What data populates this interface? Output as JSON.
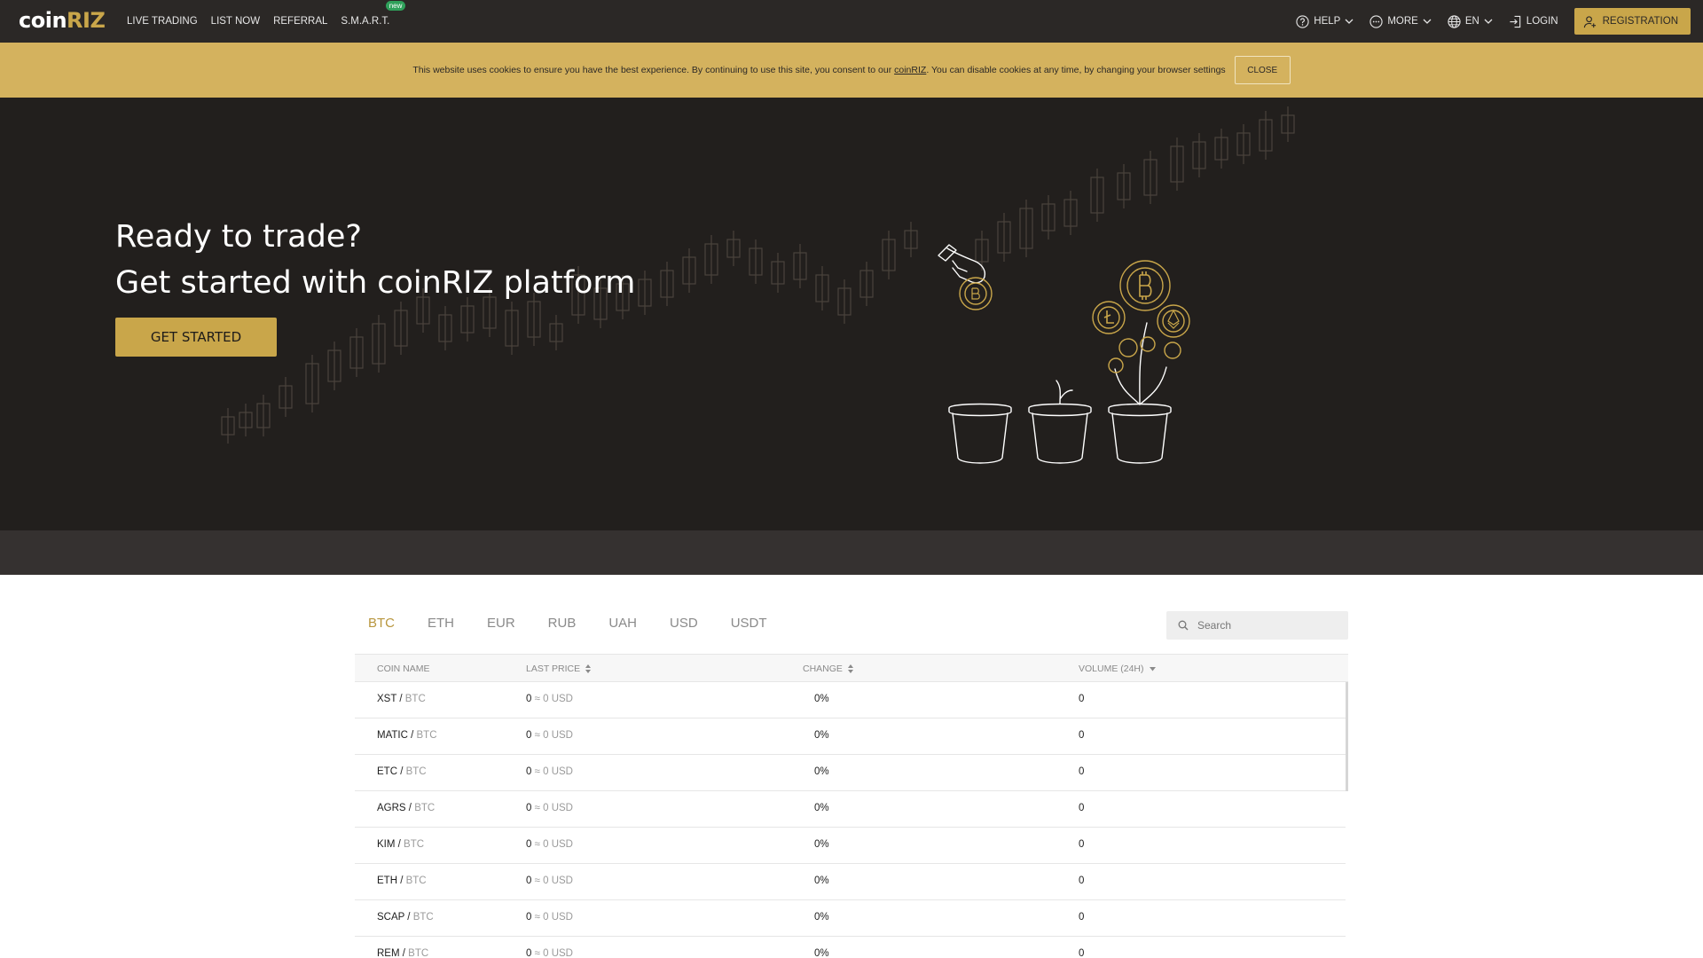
{
  "brand": {
    "logo_prefix": "coin",
    "logo_suffix": "RIZ",
    "accent": "#c9a64a"
  },
  "nav": {
    "links": [
      "LIVE TRADING",
      "LIST NOW",
      "REFERRAL",
      "S.M.A.R.T."
    ],
    "new_badge": "new",
    "help": "HELP",
    "more": "MORE",
    "language": "EN",
    "login": "LOGIN",
    "registration": "REGISTRATION"
  },
  "cookie": {
    "text_before": "This website uses cookies to ensure you have the best experience. By continuing to use this site, you consent to our ",
    "link": "coinRIZ",
    "text_after": ". You can disable cookies at any time, by changing your browser settings",
    "close": "CLOSE"
  },
  "hero": {
    "line1": "Ready to trade?",
    "line2": "Get started with coinRIZ platform",
    "cta": "GET STARTED"
  },
  "market": {
    "tabs": [
      "BTC",
      "ETH",
      "EUR",
      "RUB",
      "UAH",
      "USD",
      "USDT"
    ],
    "active_tab": "BTC",
    "search_placeholder": "Search",
    "columns": {
      "coin": "COIN NAME",
      "price": "LAST PRICE",
      "change": "CHANGE",
      "volume": "VOLUME (24H)"
    },
    "rows": [
      {
        "coin": "XST",
        "quote": "BTC",
        "price": "0",
        "usd": "≈ 0 USD",
        "change": "0%",
        "volume": "0"
      },
      {
        "coin": "MATIC",
        "quote": "BTC",
        "price": "0",
        "usd": "≈ 0 USD",
        "change": "0%",
        "volume": "0"
      },
      {
        "coin": "ETC",
        "quote": "BTC",
        "price": "0",
        "usd": "≈ 0 USD",
        "change": "0%",
        "volume": "0"
      },
      {
        "coin": "AGRS",
        "quote": "BTC",
        "price": "0",
        "usd": "≈ 0 USD",
        "change": "0%",
        "volume": "0"
      },
      {
        "coin": "KIM",
        "quote": "BTC",
        "price": "0",
        "usd": "≈ 0 USD",
        "change": "0%",
        "volume": "0"
      },
      {
        "coin": "ETH",
        "quote": "BTC",
        "price": "0",
        "usd": "≈ 0 USD",
        "change": "0%",
        "volume": "0"
      },
      {
        "coin": "SCAP",
        "quote": "BTC",
        "price": "0",
        "usd": "≈ 0 USD",
        "change": "0%",
        "volume": "0"
      },
      {
        "coin": "REM",
        "quote": "BTC",
        "price": "0",
        "usd": "≈ 0 USD",
        "change": "0%",
        "volume": "0"
      }
    ]
  }
}
